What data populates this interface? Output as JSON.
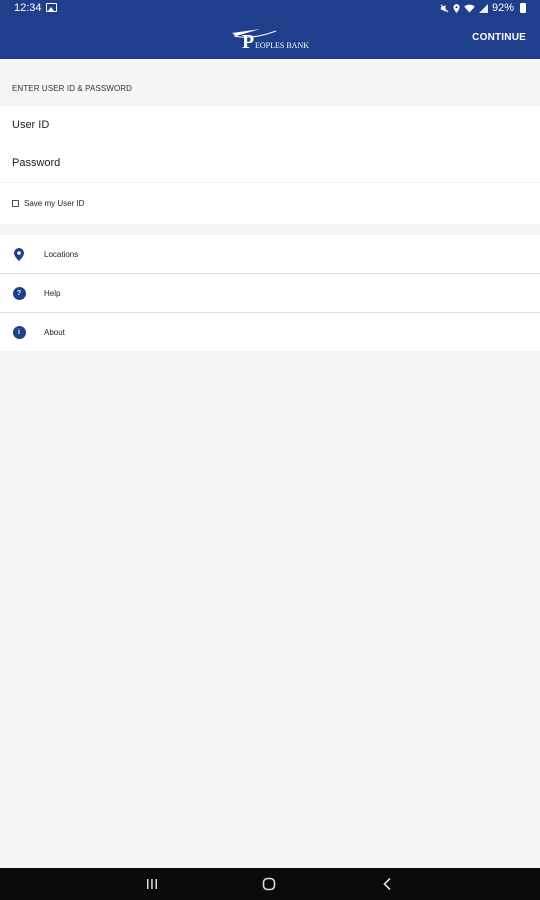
{
  "status_bar": {
    "time": "12:34",
    "battery": "92%",
    "icons": [
      "image-icon",
      "mute-icon",
      "location-icon",
      "wifi-icon",
      "signal-icon",
      "battery-icon"
    ]
  },
  "header": {
    "logo_text": "PEOPLES BANK",
    "continue_label": "CONTINUE",
    "background_color": "#1f3f8c"
  },
  "login": {
    "section_label": "ENTER USER ID & PASSWORD",
    "user_id_placeholder": "User ID",
    "password_placeholder": "Password",
    "save_user_id_label": "Save my User ID",
    "save_user_id_checked": false
  },
  "menu": {
    "items": [
      {
        "label": "Locations",
        "icon": "location-pin-icon"
      },
      {
        "label": "Help",
        "icon": "help-icon",
        "glyph": "?"
      },
      {
        "label": "About",
        "icon": "info-icon",
        "glyph": "i"
      }
    ]
  },
  "nav_bar": {
    "buttons": [
      "recent-apps-icon",
      "home-icon",
      "back-icon"
    ]
  }
}
